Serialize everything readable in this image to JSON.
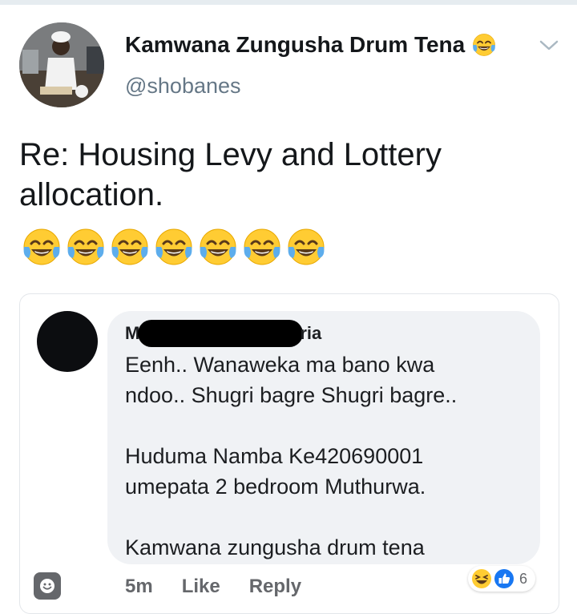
{
  "tweet": {
    "display_name": "Kamwana Zungusha Drum Tena",
    "handle": "@shobanes",
    "text": "Re: Housing Levy and Lottery allocation.",
    "emoji_count": 7,
    "emoji_icon": "tears-of-joy-emoji"
  },
  "comment": {
    "name_start": "M",
    "name_end": "ria",
    "lines": [
      "Eenh.. Wanaweka ma bano kwa",
      "ndoo.. Shugri bagre Shugri bagre..",
      "",
      "Huduma Namba Ke420690001",
      "umepata 2 bedroom Muthurwa.",
      "",
      "Kamwana zungusha drum tena"
    ],
    "time": "5m",
    "like_label": "Like",
    "reply_label": "Reply",
    "reaction_count": "6",
    "reactions": [
      "laughing-emoji",
      "like-thumb-icon"
    ]
  },
  "colors": {
    "like_blue": "#1877f2",
    "emoji_yellow": "#ffcc33",
    "tear_blue": "#5dadec",
    "secondary_text": "#657786"
  }
}
